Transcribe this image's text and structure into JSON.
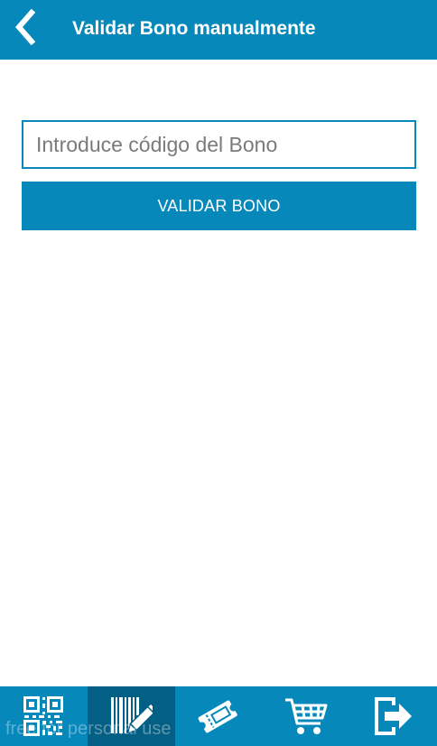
{
  "colors": {
    "primary": "#0688bb",
    "nav_active": "#045f85",
    "white": "#ffffff",
    "placeholder": "#7a7a7a"
  },
  "header": {
    "back_icon": "chevron-left-icon",
    "title": "Validar Bono manualmente"
  },
  "form": {
    "code_input": {
      "value": "",
      "placeholder": "Introduce código del Bono"
    },
    "validate_button_label": "VALIDAR BONO"
  },
  "bottom_nav": {
    "items": [
      {
        "icon": "qr-code-icon",
        "active": false
      },
      {
        "icon": "barcode-edit-icon",
        "active": true
      },
      {
        "icon": "tickets-icon",
        "active": false
      },
      {
        "icon": "shopping-cart-icon",
        "active": false
      },
      {
        "icon": "logout-icon",
        "active": false
      }
    ]
  },
  "watermark": "free for personal use"
}
